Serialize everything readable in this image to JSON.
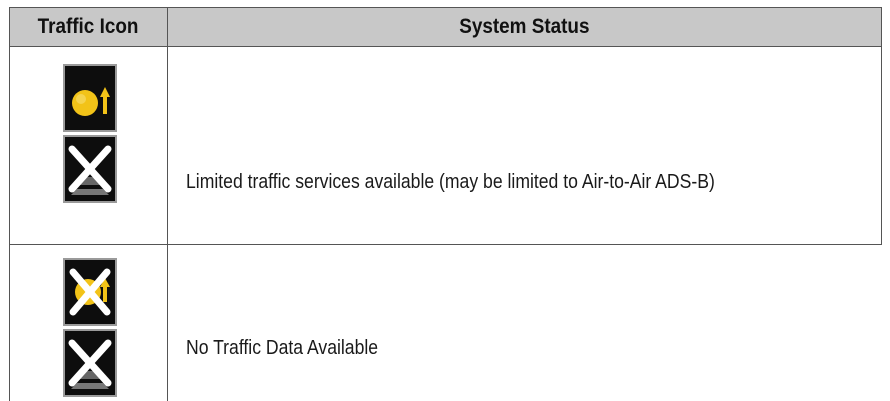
{
  "header": {
    "col_icon": "Traffic Icon",
    "col_status": "System Status"
  },
  "rows": [
    {
      "status": "Limited traffic services available (may be limited to Air-to-Air ADS-B)",
      "icons": [
        "traffic-target-up-arrow-icon",
        "traffic-failed-x-icon"
      ]
    },
    {
      "status": "No Traffic Data Available",
      "icons": [
        "traffic-target-crossed-out-icon",
        "traffic-failed-x-icon"
      ]
    }
  ],
  "colors": {
    "header_bg": "#c8c8c8",
    "icon_bg": "#0d0d0d",
    "target_yellow": "#f2c318",
    "x_white": "#ffffff"
  }
}
